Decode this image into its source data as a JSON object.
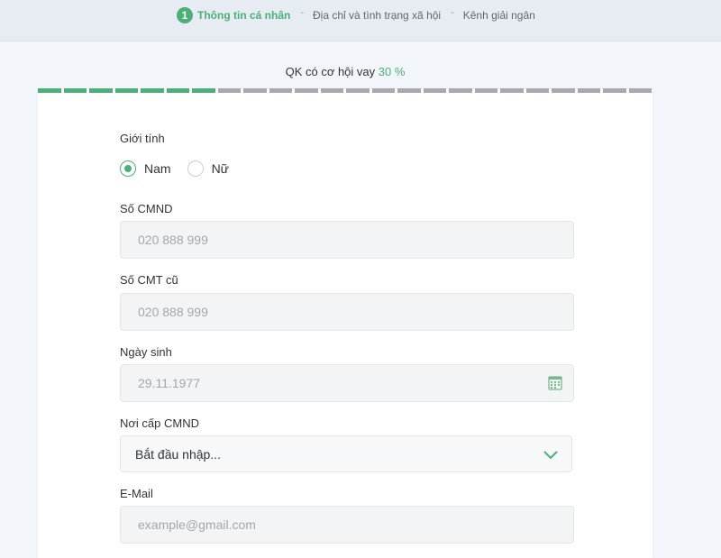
{
  "steps": {
    "current_number": "1",
    "current_label": "Thông tin cá nhân",
    "separator": "-",
    "step2_label": "Địa chỉ và tình trạng xã hội",
    "step3_label": "Kênh giải ngân"
  },
  "progress": {
    "text": "QK có cơ hội vay",
    "percent_text": "30 %",
    "value_percent": 30,
    "segments_total": 24,
    "segments_done": 7
  },
  "colors": {
    "accent": "#4caf7a",
    "segment_inactive": "#a7a9ad"
  },
  "form": {
    "gender": {
      "label": "Giới tính",
      "options": [
        "Nam",
        "Nữ"
      ],
      "selected": "Nam"
    },
    "id_number": {
      "label": "Số CMND",
      "placeholder": "020 888 999"
    },
    "old_id": {
      "label": "Số CMT cũ",
      "placeholder": "020 888 999"
    },
    "birth_date": {
      "label": "Ngày sinh",
      "placeholder": "29.11.1977",
      "icon": "calendar-icon"
    },
    "issue_place": {
      "label": "Nơi cấp CMND",
      "value": "Bắt đầu nhập...",
      "icon": "chevron-down-icon"
    },
    "email": {
      "label": "E-Mail",
      "placeholder": "example@gmail.com"
    }
  }
}
